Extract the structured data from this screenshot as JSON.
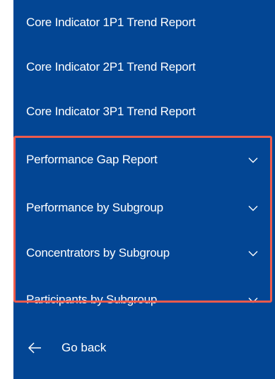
{
  "nav": {
    "items": [
      {
        "label": "Core Indicator 1P1 Trend Report"
      },
      {
        "label": "Core Indicator 2P1 Trend Report"
      },
      {
        "label": "Core Indicator 3P1 Trend Report"
      },
      {
        "label": "Performance Gap Report",
        "icon": "chevron-down-icon"
      },
      {
        "label": "Performance by Subgroup",
        "icon": "chevron-down-icon"
      },
      {
        "label": "Concentrators by Subgroup",
        "icon": "chevron-down-icon"
      },
      {
        "label": "Participants by Subgroup",
        "icon": "chevron-down-icon"
      }
    ],
    "back": {
      "label": "Go back",
      "icon": "arrow-left-icon"
    }
  },
  "colors": {
    "panel_bg": "#034694",
    "text": "#ffffff",
    "highlight_border": "#ee5b4c"
  }
}
